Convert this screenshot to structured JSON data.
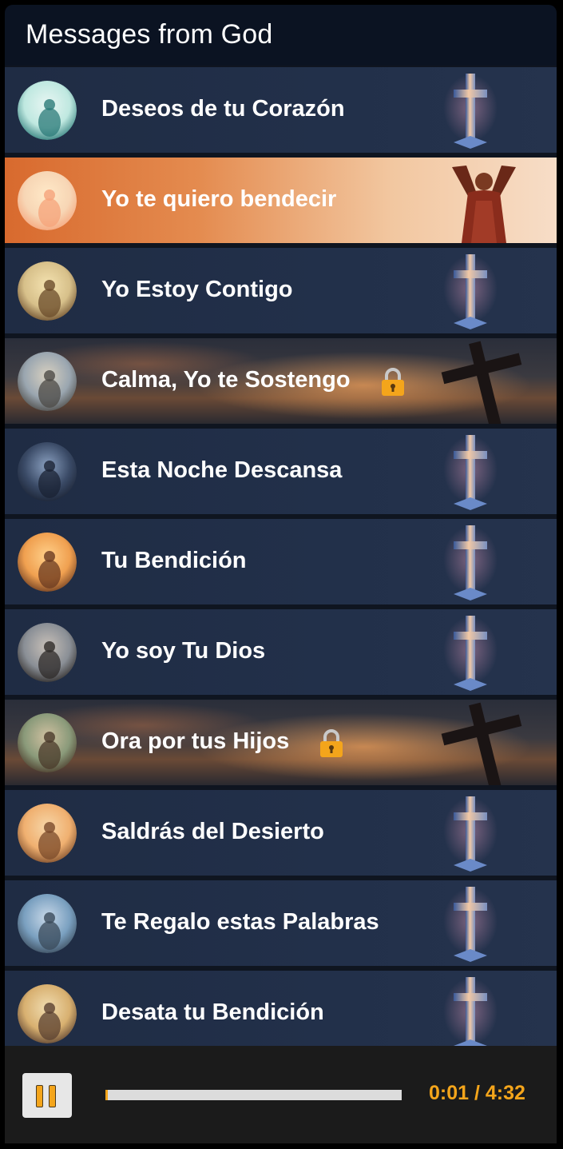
{
  "header": {
    "title": "Messages from God"
  },
  "messages": [
    {
      "label": "Deseos de tu Corazón",
      "locked": false,
      "active": false,
      "style": "default"
    },
    {
      "label": "Yo te quiero bendecir",
      "locked": false,
      "active": true,
      "style": "active"
    },
    {
      "label": "Yo Estoy Contigo",
      "locked": false,
      "active": false,
      "style": "default"
    },
    {
      "label": "Calma, Yo te Sostengo",
      "locked": true,
      "active": false,
      "style": "premium"
    },
    {
      "label": "Esta Noche Descansa",
      "locked": false,
      "active": false,
      "style": "default"
    },
    {
      "label": "Tu Bendición",
      "locked": false,
      "active": false,
      "style": "default"
    },
    {
      "label": "Yo soy Tu Dios",
      "locked": false,
      "active": false,
      "style": "default"
    },
    {
      "label": "Ora por tus Hijos",
      "locked": true,
      "active": false,
      "style": "premium"
    },
    {
      "label": "Saldrás del Desierto",
      "locked": false,
      "active": false,
      "style": "default"
    },
    {
      "label": "Te Regalo estas Palabras",
      "locked": false,
      "active": false,
      "style": "default"
    },
    {
      "label": "Desata tu Bendición",
      "locked": false,
      "active": false,
      "style": "default"
    }
  ],
  "player": {
    "state": "playing",
    "control_icon": "pause-icon",
    "time_display": "0:01 / 4:32",
    "progress_fraction": 0.004
  },
  "colors": {
    "accent": "#f4a51b",
    "row_bg": "#22304a",
    "header_bg": "#0b1322",
    "active_start": "#d86a2e",
    "active_end": "#f7ddc7"
  }
}
